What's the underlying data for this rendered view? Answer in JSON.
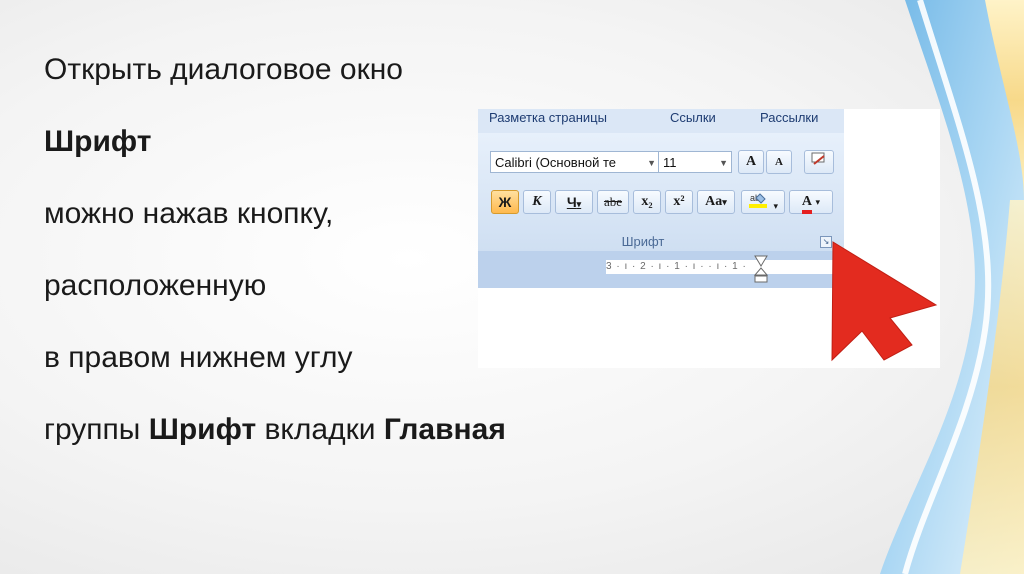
{
  "slide": {
    "line1": "Открыть диалоговое окно",
    "line2": "Шрифт",
    "line3": "можно нажав кнопку,",
    "line4": "расположенную",
    "line5": "в правом нижнем углу",
    "line6_a": "группы ",
    "line6_b": "Шрифт",
    "line6_c": " вкладки ",
    "line6_d": "Главная"
  },
  "ribbon": {
    "tabs": [
      "Разметка страницы",
      "Ссылки",
      "Рассылки"
    ],
    "font_name": "Calibri (Основной те",
    "font_size": "11",
    "grow_font": "A",
    "shrink_font": "A",
    "bold": "Ж",
    "italic": "К",
    "underline": "Ч",
    "strikethrough": "abe",
    "subscript": "x₂",
    "superscript": "x²",
    "change_case": "Aa",
    "font_color": "A",
    "group_label": "Шрифт",
    "ruler_text": "3 · ı · 2 · ı · 1 · ı ·   · ı · 1 ·"
  },
  "colors": {
    "arrow": "#e32b1f",
    "ribbon_bg": "#dbe7f6",
    "active_button": "#ffb94d"
  },
  "icons": [
    "clear-formatting-icon",
    "highlight-icon",
    "font-color-icon",
    "dialog-launcher-icon",
    "cursor-arrow-icon"
  ]
}
